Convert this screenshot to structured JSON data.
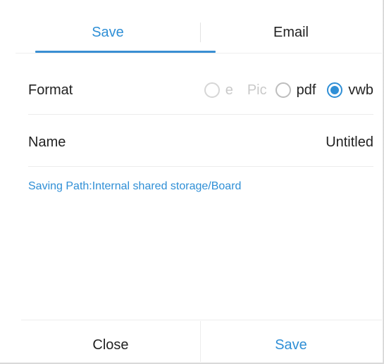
{
  "tabs": [
    {
      "label": "Save",
      "active": true
    },
    {
      "label": "Email",
      "active": false
    }
  ],
  "format": {
    "label": "Format",
    "options": [
      {
        "label": "e",
        "checked": false,
        "enabled": false
      },
      {
        "label": "Pic",
        "checked": false,
        "enabled": false
      },
      {
        "label": "pdf",
        "checked": false,
        "enabled": true
      },
      {
        "label": "vwb",
        "checked": true,
        "enabled": true
      }
    ]
  },
  "name": {
    "label": "Name",
    "value": "Untitled"
  },
  "saving_path": "Saving Path:Internal shared storage/Board",
  "footer": {
    "close_label": "Close",
    "save_label": "Save"
  },
  "colors": {
    "accent": "#2f8fd6",
    "text": "#222222",
    "disabled": "#c9c9c9"
  }
}
